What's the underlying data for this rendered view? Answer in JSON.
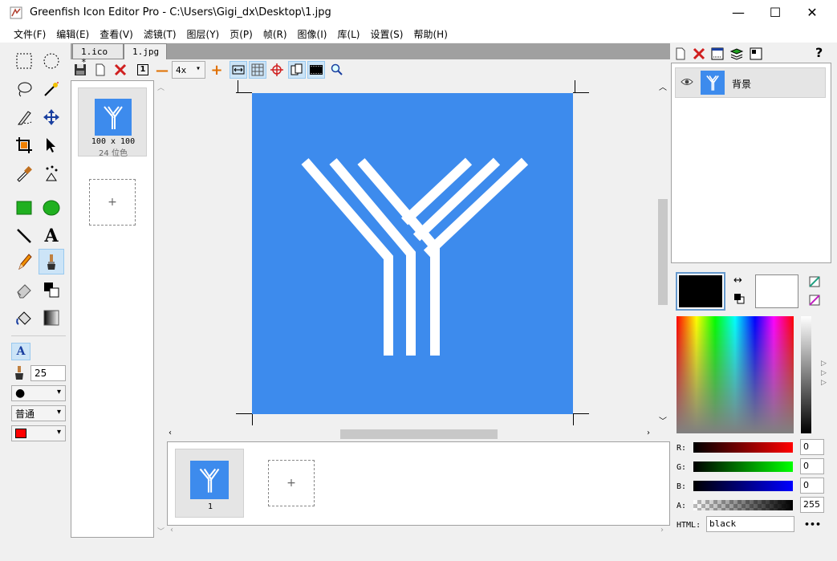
{
  "window": {
    "title": "Greenfish Icon Editor Pro - C:\\Users\\Gigi_dx\\Desktop\\1.jpg",
    "minimize": "—",
    "maximize": "☐",
    "close": "✕"
  },
  "menu": [
    {
      "id": "file",
      "label": "文件(F)"
    },
    {
      "id": "edit",
      "label": "编辑(E)"
    },
    {
      "id": "view",
      "label": "查看(V)"
    },
    {
      "id": "filter",
      "label": "滤镜(T)"
    },
    {
      "id": "layer",
      "label": "图层(Y)"
    },
    {
      "id": "page",
      "label": "页(P)"
    },
    {
      "id": "frame",
      "label": "帧(R)"
    },
    {
      "id": "image",
      "label": "图像(I)"
    },
    {
      "id": "library",
      "label": "库(L)"
    },
    {
      "id": "settings",
      "label": "设置(S)"
    },
    {
      "id": "help",
      "label": "帮助(H)"
    }
  ],
  "toolbox": {
    "brush_size": "25",
    "brush_shape": "●",
    "blend_mode": "普通",
    "fill_color": "#ff0000",
    "text_mode": "A"
  },
  "doc_tabs": [
    {
      "label": "1.ico *",
      "active": false
    },
    {
      "label": "1.jpg",
      "active": true
    }
  ],
  "sub_toolbar": {
    "zoom_label": "4x",
    "minus": "—",
    "plus": "+",
    "page_index": "1"
  },
  "page_strip": {
    "thumb_size": "100 x 100",
    "thumb_depth": "24 位色",
    "add_label": "+"
  },
  "frame_strip": {
    "frame_label": "1",
    "add_label": "+"
  },
  "canvas": {
    "bg_color": "#3d8bed",
    "mark_color": "#ffffff"
  },
  "layers": {
    "help": "?",
    "items": [
      {
        "name": "背景"
      }
    ]
  },
  "color": {
    "primary": "#000000",
    "secondary": "#ffffff",
    "swap": "↔",
    "channels": [
      {
        "label": "R:",
        "value": "0",
        "color": "#ff0000"
      },
      {
        "label": "G:",
        "value": "0",
        "color": "#00ff00"
      },
      {
        "label": "B:",
        "value": "0",
        "color": "#0000ff"
      },
      {
        "label": "A:",
        "value": "255",
        "color": "#000000"
      }
    ],
    "html_label": "HTML:",
    "html_value": "black",
    "more": "•••"
  }
}
